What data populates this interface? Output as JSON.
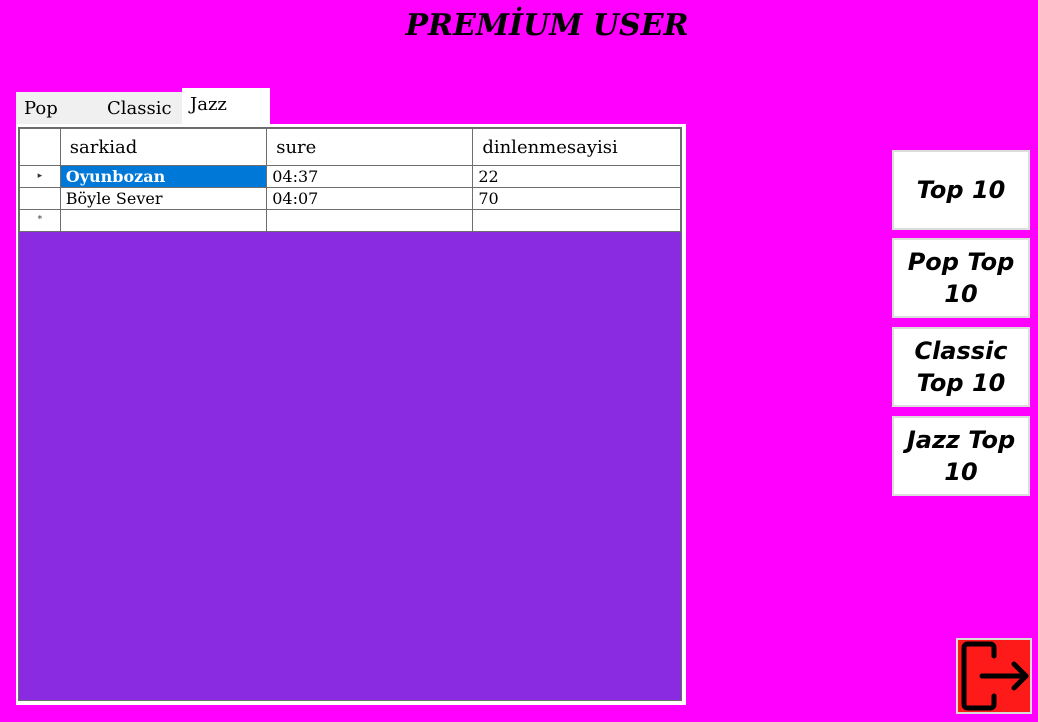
{
  "title": "PREMİUM USER",
  "tabs": [
    {
      "label": "Pop"
    },
    {
      "label": "Classic"
    },
    {
      "label": "Jazz"
    }
  ],
  "active_tab": "Jazz",
  "grid": {
    "columns": [
      "sarkiad",
      "sure",
      "dinlenmesayisi"
    ],
    "rows": [
      {
        "sarkiad": "Oyunbozan",
        "sure": "04:37",
        "dinlenmesayisi": "22"
      },
      {
        "sarkiad": "Böyle Sever",
        "sure": "04:07",
        "dinlenmesayisi": "70"
      }
    ],
    "current_row_marker": "▸",
    "new_row_marker": "*"
  },
  "buttons": {
    "top10": "Top 10",
    "pop_top10": "Pop Top 10",
    "classic_top10": "Classic Top 10",
    "jazz_top10": "Jazz Top 10"
  },
  "exit": {
    "icon": "exit-icon"
  },
  "colors": {
    "background": "#ff00ff",
    "grid_background": "#8a2be2",
    "selection": "#0078d7",
    "exit_button": "#ff1a1a"
  }
}
